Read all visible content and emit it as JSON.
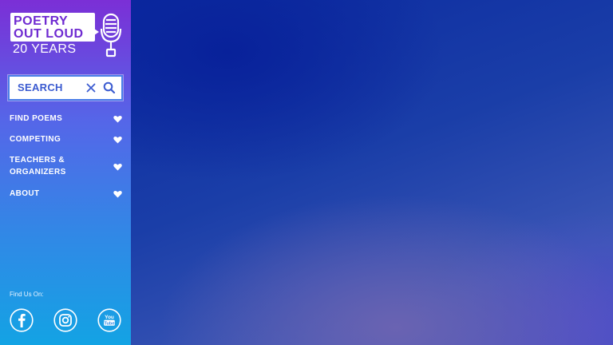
{
  "brand": {
    "line1": "POETRY",
    "line2": "OUT LOUD",
    "years": "20 YEARS"
  },
  "search": {
    "label": "SEARCH",
    "clear_icon": "close-icon",
    "search_icon": "search-icon"
  },
  "nav": {
    "items": [
      {
        "label": "FIND POEMS"
      },
      {
        "label": "COMPETING"
      },
      {
        "label": "TEACHERS & ORGANIZERS"
      },
      {
        "label": "ABOUT"
      }
    ]
  },
  "footer": {
    "find_us": "Find Us On:",
    "social": [
      "facebook-icon",
      "instagram-icon",
      "youtube-icon"
    ],
    "youtube_text": "You Tube"
  },
  "colors": {
    "sidebar_top": "#7b2fd6",
    "sidebar_bottom": "#13a3e4",
    "brand_purple": "#6f2bd1",
    "main_bg": "#1a3ea8"
  }
}
